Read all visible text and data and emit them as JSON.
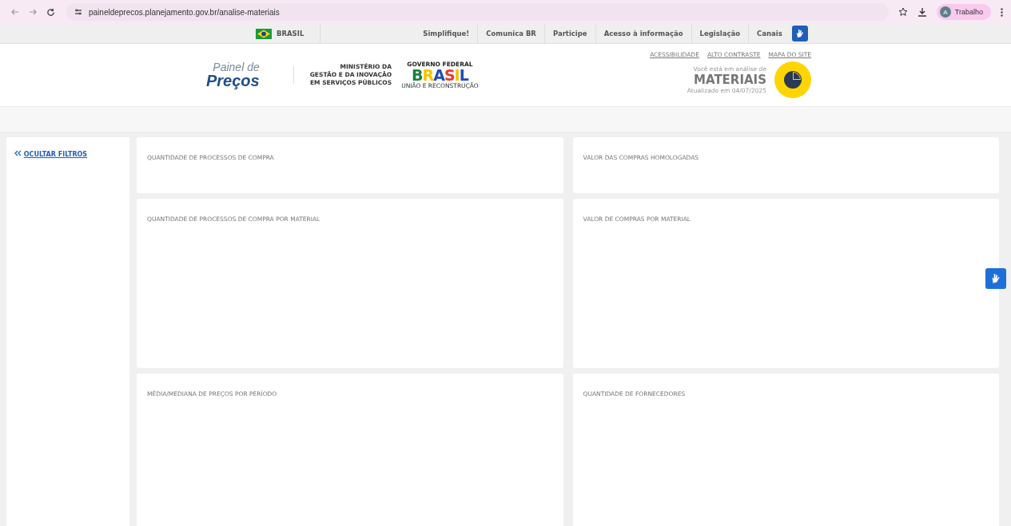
{
  "browser": {
    "url": "paineldeprecos.planejamento.gov.br/analise-materiais",
    "profile_initial": "A",
    "profile_name": "Trabalho"
  },
  "gov_bar": {
    "country": "BRASIL",
    "links": [
      "Simplifique!",
      "Comunica BR",
      "Participe",
      "Acesso à informação",
      "Legislação",
      "Canais"
    ]
  },
  "header": {
    "logo_top": "Painel de",
    "logo_bottom": "Preços",
    "ministry": [
      "MINISTÉRIO DA",
      "GESTÃO E DA INOVAÇÃO",
      "EM SERVIÇOS PÚBLICOS"
    ],
    "gov_top": "GOVERNO FEDERAL",
    "gov_word": "BRASIL",
    "gov_bottom": "UNIÃO E RECONSTRUÇÃO",
    "access_links": [
      "ACESSIBILIDADE",
      "ALTO CONTRASTE",
      "MAPA DO SITE"
    ],
    "context_label": "Você está em análise de",
    "context_value": "MATERIAIS",
    "updated": "Atualizado em 04/07/2025"
  },
  "sidebar": {
    "toggle": "OCULTAR FILTROS"
  },
  "cards": [
    {
      "title": "QUANTIDADE DE PROCESSOS DE COMPRA"
    },
    {
      "title": "VALOR DAS COMPRAS HOMOLOGADAS"
    },
    {
      "title": "QUANTIDADE DE PROCESSOS DE COMPRA POR MATERIAL"
    },
    {
      "title": "VALOR DE COMPRAS POR MATERIAL"
    },
    {
      "title": "MÉDIA/MEDIANA DE PREÇOS POR PERÍODO"
    },
    {
      "title": "QUANTIDADE DE FORNECEDORES"
    }
  ]
}
